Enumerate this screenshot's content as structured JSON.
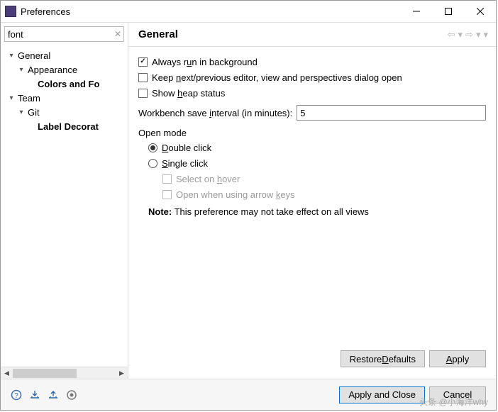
{
  "window": {
    "title": "Preferences"
  },
  "search": {
    "value": "font"
  },
  "tree": {
    "items": [
      {
        "label": "General",
        "expanded": true,
        "depth": 0
      },
      {
        "label": "Appearance",
        "expanded": true,
        "depth": 1
      },
      {
        "label": "Colors and Fo",
        "bold": true,
        "depth": 2
      },
      {
        "label": "Team",
        "expanded": true,
        "depth": 0
      },
      {
        "label": "Git",
        "expanded": true,
        "depth": 1
      },
      {
        "label": "Label Decorat",
        "bold": true,
        "depth": 2
      }
    ]
  },
  "page": {
    "heading": "General",
    "checkboxes": {
      "always_bg": {
        "label_pre": "Always r",
        "label_u": "u",
        "label_post": "n in background",
        "checked": true
      },
      "keep_next": {
        "label_pre": "Keep ",
        "label_u": "n",
        "label_post": "ext/previous editor, view and perspectives dialog open",
        "checked": false
      },
      "show_heap": {
        "label_pre": "Show ",
        "label_u": "h",
        "label_post": "eap status",
        "checked": false
      }
    },
    "save_interval": {
      "label_pre": "Workbench save ",
      "label_u": "i",
      "label_post": "nterval (in minutes):",
      "value": "5"
    },
    "open_mode": {
      "title": "Open mode",
      "double": {
        "label_u": "D",
        "label_post": "ouble click"
      },
      "single": {
        "label_u": "S",
        "label_post": "ingle click"
      },
      "hover": {
        "label_pre": "Select on ",
        "label_u": "h",
        "label_post": "over"
      },
      "arrow": {
        "label_pre": "Open when using arrow ",
        "label_u": "k",
        "label_post": "eys"
      }
    },
    "note": {
      "bold": "Note:",
      "text": " This preference may not take effect on all views"
    }
  },
  "buttons": {
    "restore": {
      "pre": "Restore ",
      "u": "D",
      "post": "efaults"
    },
    "apply": {
      "u": "A",
      "post": "pply"
    },
    "apply_close": "Apply and Close",
    "cancel": "Cancel"
  },
  "watermark": "头条 @小海洋why"
}
